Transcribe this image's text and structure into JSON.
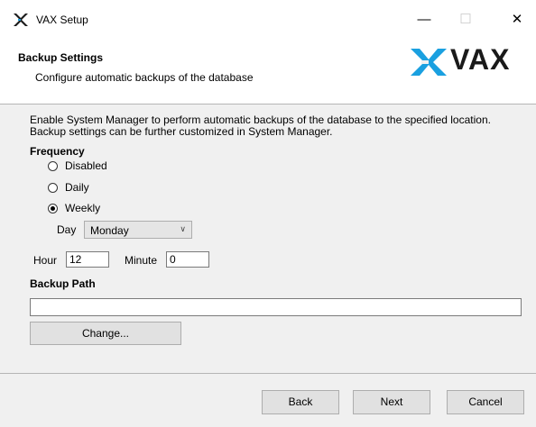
{
  "window": {
    "title": "VAX Setup",
    "minimize_glyph": "—",
    "maximize_glyph": "☐",
    "close_glyph": "✕"
  },
  "header": {
    "title": "Backup Settings",
    "subtitle": "Configure automatic backups of the database",
    "logo_text": "VAX"
  },
  "body": {
    "description": "Enable System Manager to perform automatic backups of the database to the specified location. Backup settings can be further customized in System Manager.",
    "frequency_label": "Frequency",
    "frequency_options": [
      {
        "label": "Disabled",
        "selected": false
      },
      {
        "label": "Daily",
        "selected": false
      },
      {
        "label": "Weekly",
        "selected": true
      }
    ],
    "day_label": "Day",
    "day_value": "Monday",
    "hour_label": "Hour",
    "hour_value": "12",
    "minute_label": "Minute",
    "minute_value": "0",
    "backup_path_label": "Backup Path",
    "backup_path_value": "",
    "change_label": "Change..."
  },
  "footer": {
    "back_label": "Back",
    "next_label": "Next",
    "cancel_label": "Cancel"
  },
  "colors": {
    "logo_blue": "#1aa0e0",
    "logo_dark": "#1a1a1a"
  },
  "icons": [
    "vax-app-icon",
    "vax-logo-mark",
    "radio-icon",
    "chevron-down-icon"
  ]
}
